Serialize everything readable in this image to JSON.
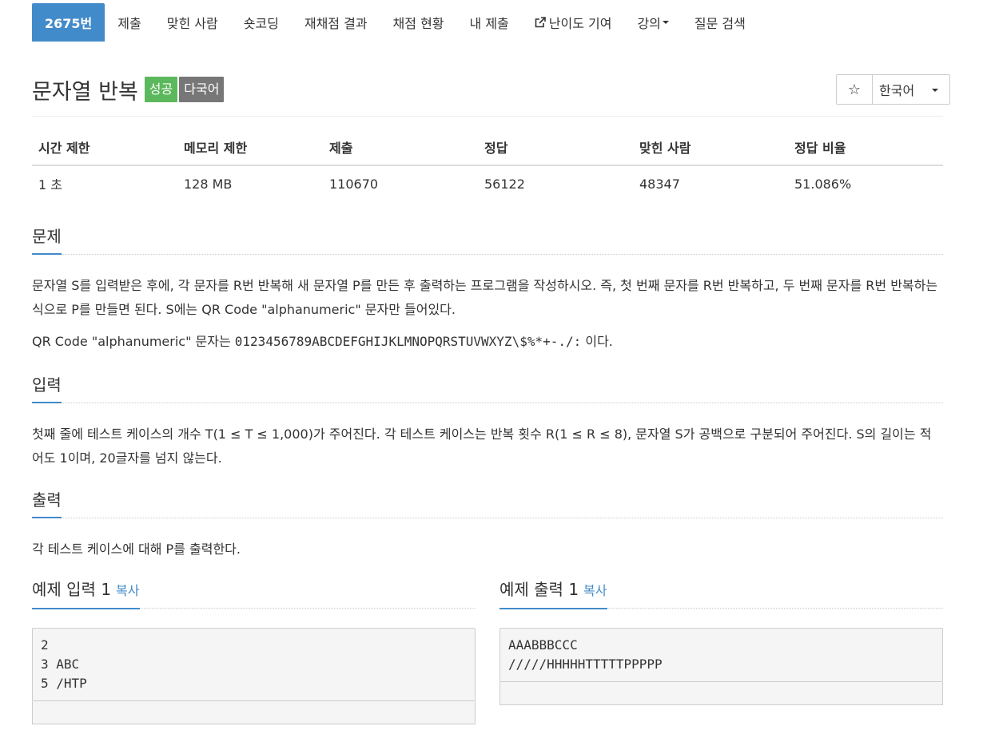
{
  "nav": {
    "tabs": [
      "2675번",
      "제출",
      "맞힌 사람",
      "숏코딩",
      "재채점 결과",
      "채점 현황",
      "내 제출"
    ],
    "difficulty": "난이도 기여",
    "lecture": "강의",
    "qna": "질문 검색"
  },
  "problem": {
    "title": "문자열 반복",
    "badge_success": "성공",
    "badge_multi": "다국어",
    "star": "☆",
    "language": "한국어"
  },
  "info": {
    "headers": [
      "시간 제한",
      "메모리 제한",
      "제출",
      "정답",
      "맞힌 사람",
      "정답 비율"
    ],
    "values": [
      "1 초",
      "128 MB",
      "110670",
      "56122",
      "48347",
      "51.086%"
    ]
  },
  "sections": {
    "problem_title": "문제",
    "problem_text_1": "문자열 S를 입력받은 후에, 각 문자를 R번 반복해 새 문자열 P를 만든 후 출력하는 프로그램을 작성하시오. 즉, 첫 번째 문자를 R번 반복하고, 두 번째 문자를 R번 반복하는 식으로 P를 만들면 된다. S에는 QR Code \"alphanumeric\" 문자만 들어있다.",
    "problem_text_2_prefix": "QR Code \"alphanumeric\" 문자는 ",
    "problem_text_2_code": "0123456789ABCDEFGHIJKLMNOPQRSTUVWXYZ\\$%*+-./:",
    "problem_text_2_suffix": " 이다.",
    "input_title": "입력",
    "input_text": "첫째 줄에 테스트 케이스의 개수 T(1 ≤ T ≤ 1,000)가 주어진다. 각 테스트 케이스는 반복 횟수 R(1 ≤ R ≤ 8), 문자열 S가 공백으로 구분되어 주어진다. S의 길이는 적어도 1이며, 20글자를 넘지 않는다.",
    "output_title": "출력",
    "output_text": "각 테스트 케이스에 대해 P를 출력한다."
  },
  "samples": {
    "input_title": "예제 입력 1",
    "output_title": "예제 출력 1",
    "copy": "복사",
    "input_text": "2\n3 ABC\n5 /HTP",
    "output_text": "AAABBBCCC\n/////HHHHHTTTTTPPPPP"
  }
}
